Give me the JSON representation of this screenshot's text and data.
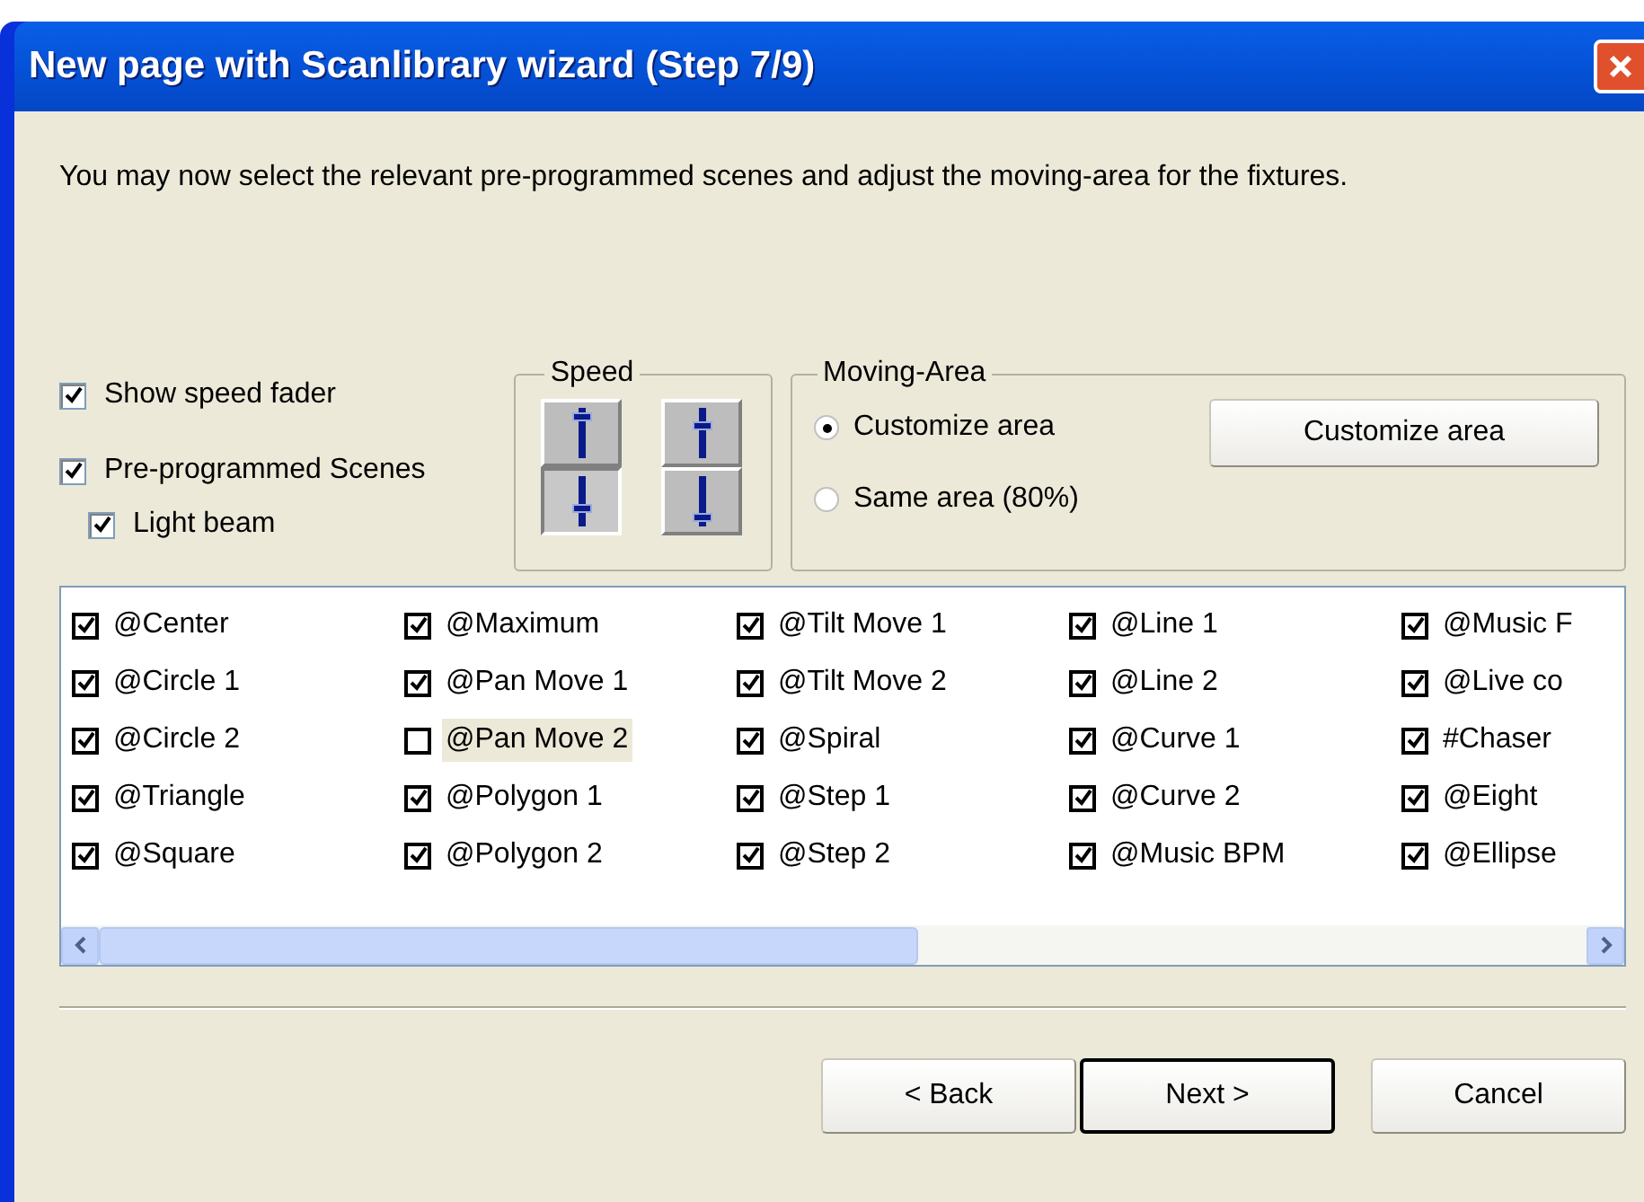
{
  "window": {
    "title": "New page with Scanlibrary wizard (Step 7/9)"
  },
  "description": "You may now select the relevant pre-programmed scenes and adjust the moving-area for the fixtures.",
  "options": [
    {
      "label": "Show speed fader",
      "checked": true,
      "indent": false
    },
    {
      "label": "Pre-programmed Scenes",
      "checked": true,
      "indent": false
    },
    {
      "label": "Light beam",
      "checked": true,
      "indent": true
    }
  ],
  "speed": {
    "title": "Speed",
    "buttons": [
      {
        "kind": "up",
        "pressed": false
      },
      {
        "kind": "mid-up",
        "pressed": false
      },
      {
        "kind": "mid-down",
        "pressed": true
      },
      {
        "kind": "down",
        "pressed": false
      }
    ]
  },
  "moving_area": {
    "title": "Moving-Area",
    "radios": [
      {
        "label": "Customize area",
        "selected": true
      },
      {
        "label": "Same area (80%)",
        "selected": false
      }
    ],
    "button": "Customize area"
  },
  "scenes": [
    {
      "label": "@Center",
      "checked": true,
      "selected": false
    },
    {
      "label": "@Circle 1",
      "checked": true,
      "selected": false
    },
    {
      "label": "@Circle 2",
      "checked": true,
      "selected": false
    },
    {
      "label": "@Triangle",
      "checked": true,
      "selected": false
    },
    {
      "label": "@Square",
      "checked": true,
      "selected": false
    },
    {
      "label": "@Maximum",
      "checked": true,
      "selected": false
    },
    {
      "label": "@Pan Move 1",
      "checked": true,
      "selected": false
    },
    {
      "label": "@Pan Move 2",
      "checked": false,
      "selected": true
    },
    {
      "label": "@Polygon 1",
      "checked": true,
      "selected": false
    },
    {
      "label": "@Polygon 2",
      "checked": true,
      "selected": false
    },
    {
      "label": "@Tilt Move 1",
      "checked": true,
      "selected": false
    },
    {
      "label": "@Tilt Move 2",
      "checked": true,
      "selected": false
    },
    {
      "label": "@Spiral",
      "checked": true,
      "selected": false
    },
    {
      "label": "@Step 1",
      "checked": true,
      "selected": false
    },
    {
      "label": "@Step 2",
      "checked": true,
      "selected": false
    },
    {
      "label": "@Line 1",
      "checked": true,
      "selected": false
    },
    {
      "label": "@Line 2",
      "checked": true,
      "selected": false
    },
    {
      "label": "@Curve 1",
      "checked": true,
      "selected": false
    },
    {
      "label": "@Curve 2",
      "checked": true,
      "selected": false
    },
    {
      "label": "@Music BPM",
      "checked": true,
      "selected": false
    },
    {
      "label": "@Music F",
      "checked": true,
      "selected": false
    },
    {
      "label": "@Live co",
      "checked": true,
      "selected": false
    },
    {
      "label": "#Chaser",
      "checked": true,
      "selected": false
    },
    {
      "label": "@Eight",
      "checked": true,
      "selected": false
    },
    {
      "label": "@Ellipse",
      "checked": true,
      "selected": false
    }
  ],
  "buttons": [
    {
      "label": "< Back",
      "default": false
    },
    {
      "label": "Next >",
      "default": true
    },
    {
      "label": "Cancel",
      "default": false
    }
  ]
}
